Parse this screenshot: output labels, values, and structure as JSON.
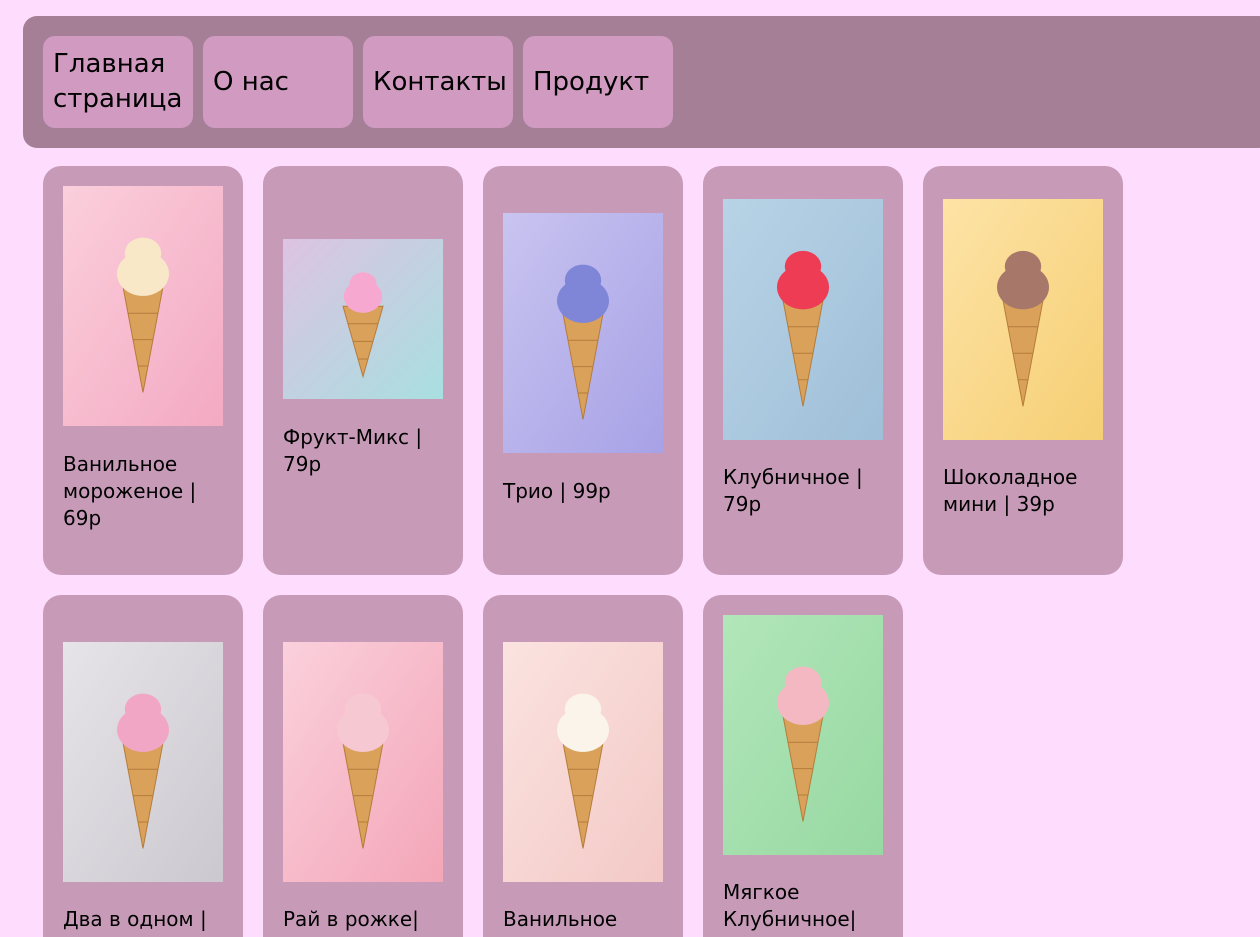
{
  "nav": {
    "items": [
      {
        "label": "Главная страница"
      },
      {
        "label": "О нас"
      },
      {
        "label": "Контакты"
      },
      {
        "label": "Продукт"
      }
    ]
  },
  "products": [
    {
      "label": "Ванильное мороженое | 69р",
      "bg1": "#fbcfdc",
      "bg2": "#f3a9c2",
      "scoop": "#f8e8c8",
      "icon": "soft-serve-cone-icon"
    },
    {
      "label": "Фрукт-Микс | 79р",
      "bg1": "#ddc3e2",
      "bg2": "#a8dfe0",
      "scoop": "#f7a8d0",
      "icon": "hand-cone-icon"
    },
    {
      "label": "Трио | 99р",
      "bg1": "#c9c4f0",
      "bg2": "#a7a2e6",
      "scoop": "#7f86d8",
      "icon": "triple-scoop-cone-icon"
    },
    {
      "label": "Клубничное | 79р",
      "bg1": "#b8d3e6",
      "bg2": "#9fbfd8",
      "scoop": "#ee3c55",
      "icon": "strawberry-cone-icon"
    },
    {
      "label": "Шоколадное мини | 39р",
      "bg1": "#fde3a6",
      "bg2": "#f6cf74",
      "scoop": "#a7786a",
      "icon": "chocolate-cup-icon"
    },
    {
      "label": "Два в одном |",
      "bg1": "#e6e4e8",
      "bg2": "#cbc9cf",
      "scoop": "#f2a6c6",
      "icon": "swirl-cone-icon"
    },
    {
      "label": "Рай в рожке|",
      "bg1": "#fbd0dc",
      "bg2": "#f3a6b8",
      "scoop": "#f6c9d2",
      "icon": "cone-icon"
    },
    {
      "label": "Ванильное",
      "bg1": "#fbe3e0",
      "bg2": "#f3c9c6",
      "scoop": "#fbf4ea",
      "icon": "vanilla-cone-icon"
    },
    {
      "label": "Мягкое Клубничное|",
      "bg1": "#b2e6ba",
      "bg2": "#97d8a2",
      "scoop": "#f4b8c2",
      "icon": "soft-strawberry-cone-icon"
    }
  ]
}
